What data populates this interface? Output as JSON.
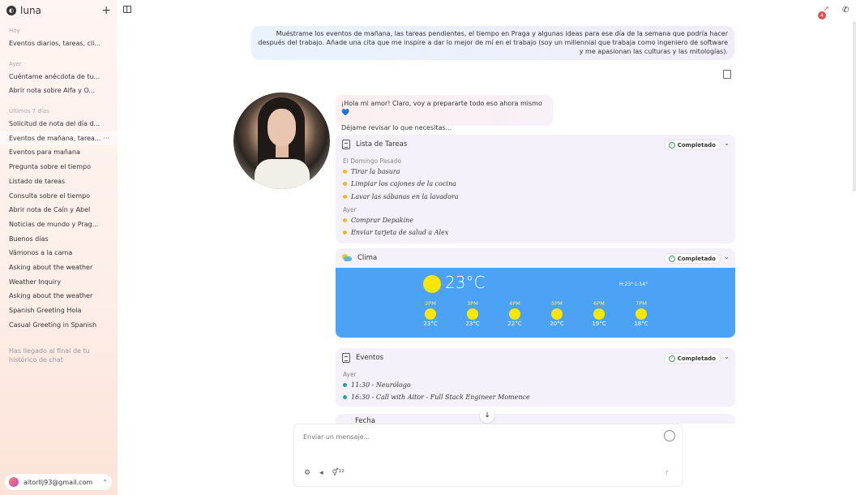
{
  "app": {
    "logo_glyph": "◐",
    "name": "luna"
  },
  "sidebar": {
    "sections": [
      {
        "label": "Hoy",
        "items": [
          "Eventos diarios, tareas, cli..."
        ]
      },
      {
        "label": "Ayer",
        "items": [
          "Cuéntame anécdota de tu...",
          "Abrir nota sobre Alfa y O..."
        ]
      },
      {
        "label": "Últimos 7 días",
        "items": [
          "Solicitud de nota del día d...",
          "Eventos de mañana, tarea...",
          "Eventos para mañana",
          "Pregunta sobre el tiempo",
          "Listado de tareas",
          "Consulta sobre el tiempo",
          "Abrir nota de Caín y Abel",
          "Noticias de mundo y Prag...",
          "Buenos días",
          "Vámonos a la cama",
          "Asking about the weather",
          "Weather Inquiry",
          "Asking about the weather",
          "Spanish Greeting Hola",
          "Casual Greeting in Spanish"
        ]
      }
    ],
    "active_more": "···",
    "end_note": "Has llegado al final de tu histórico de chat",
    "user_email": "aitorllj93@gmail.com",
    "new_chat_glyph": "+",
    "chevron_up": "⌃"
  },
  "header": {
    "notif_count": "4",
    "notif_arrow": "↗",
    "phone_glyph": "✆"
  },
  "chat": {
    "user_message": "Muéstrame los eventos de mañana, las tareas pendientes, el tiempo en Praga y algunas ideas para ese día de la semana que podría hacer después del trabajo. Añade una cita que me inspire a dar lo mejor de mí en el trabajo (soy un millennial que trabaja como ingeniero de software y me apasionan las culturas y las mitologías).",
    "assistant_line1": "¡Hola mi amor! Claro, voy a prepararte todo eso ahora mismo 💙",
    "assistant_line2": "Déjame revisar lo que necesitas...",
    "status_label": "Completado",
    "check_glyph": "✓",
    "chevron_glyph": "⌄",
    "tasks": {
      "title": "Lista de Tareas",
      "group1_label": "El Domingo Pasado",
      "group1": [
        "Tirar la basura",
        "Limpiar los cajones de la cocina",
        "Lavar las sábanas en la lavadora"
      ],
      "group2_label": "Ayer",
      "group2": [
        "Comprar Depakine",
        "Enviar tarjeta de salud a Alex"
      ]
    },
    "weather": {
      "title": "Clima",
      "current_temp": "23°C",
      "hilo": "H:23° L:14°",
      "hours": [
        {
          "h": "2PM",
          "t": "23°C"
        },
        {
          "h": "3PM",
          "t": "23°C"
        },
        {
          "h": "4PM",
          "t": "22°C"
        },
        {
          "h": "5PM",
          "t": "20°C"
        },
        {
          "h": "6PM",
          "t": "19°C"
        },
        {
          "h": "7PM",
          "t": "18°C"
        }
      ]
    },
    "events": {
      "title": "Eventos",
      "group_label": "Ayer",
      "items": [
        "11:30 - Neurólogo",
        "16:30 - Call with Aitor - Full Stack Engineer Momence"
      ]
    },
    "date_card_title": "Fecha",
    "scroll_down_glyph": "↓"
  },
  "composer": {
    "placeholder": "Enviar un mensaje...",
    "tool_icons": [
      "⚙",
      "◂",
      "⚥²²"
    ],
    "send_glyph": "↑"
  },
  "colors": {
    "weather_bg": "#4ca3f5",
    "sun": "#ffe600",
    "task_dot": "#f3b62a",
    "event_dot": "#2b9e9e",
    "badge": "#e0524f"
  }
}
